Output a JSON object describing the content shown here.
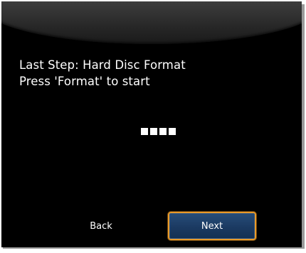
{
  "dialog": {
    "line1": "Last Step: Hard Disc Format",
    "line2": "Press 'Format' to start"
  },
  "progress": {
    "indicator_count": 4,
    "color": "#ffffff"
  },
  "buttons": {
    "back_label": "Back",
    "next_label": "Next"
  },
  "colors": {
    "background": "#000000",
    "text": "#ffffff",
    "focus_border": "#e89a2a",
    "focused_button_fill": "#1b3a62"
  }
}
